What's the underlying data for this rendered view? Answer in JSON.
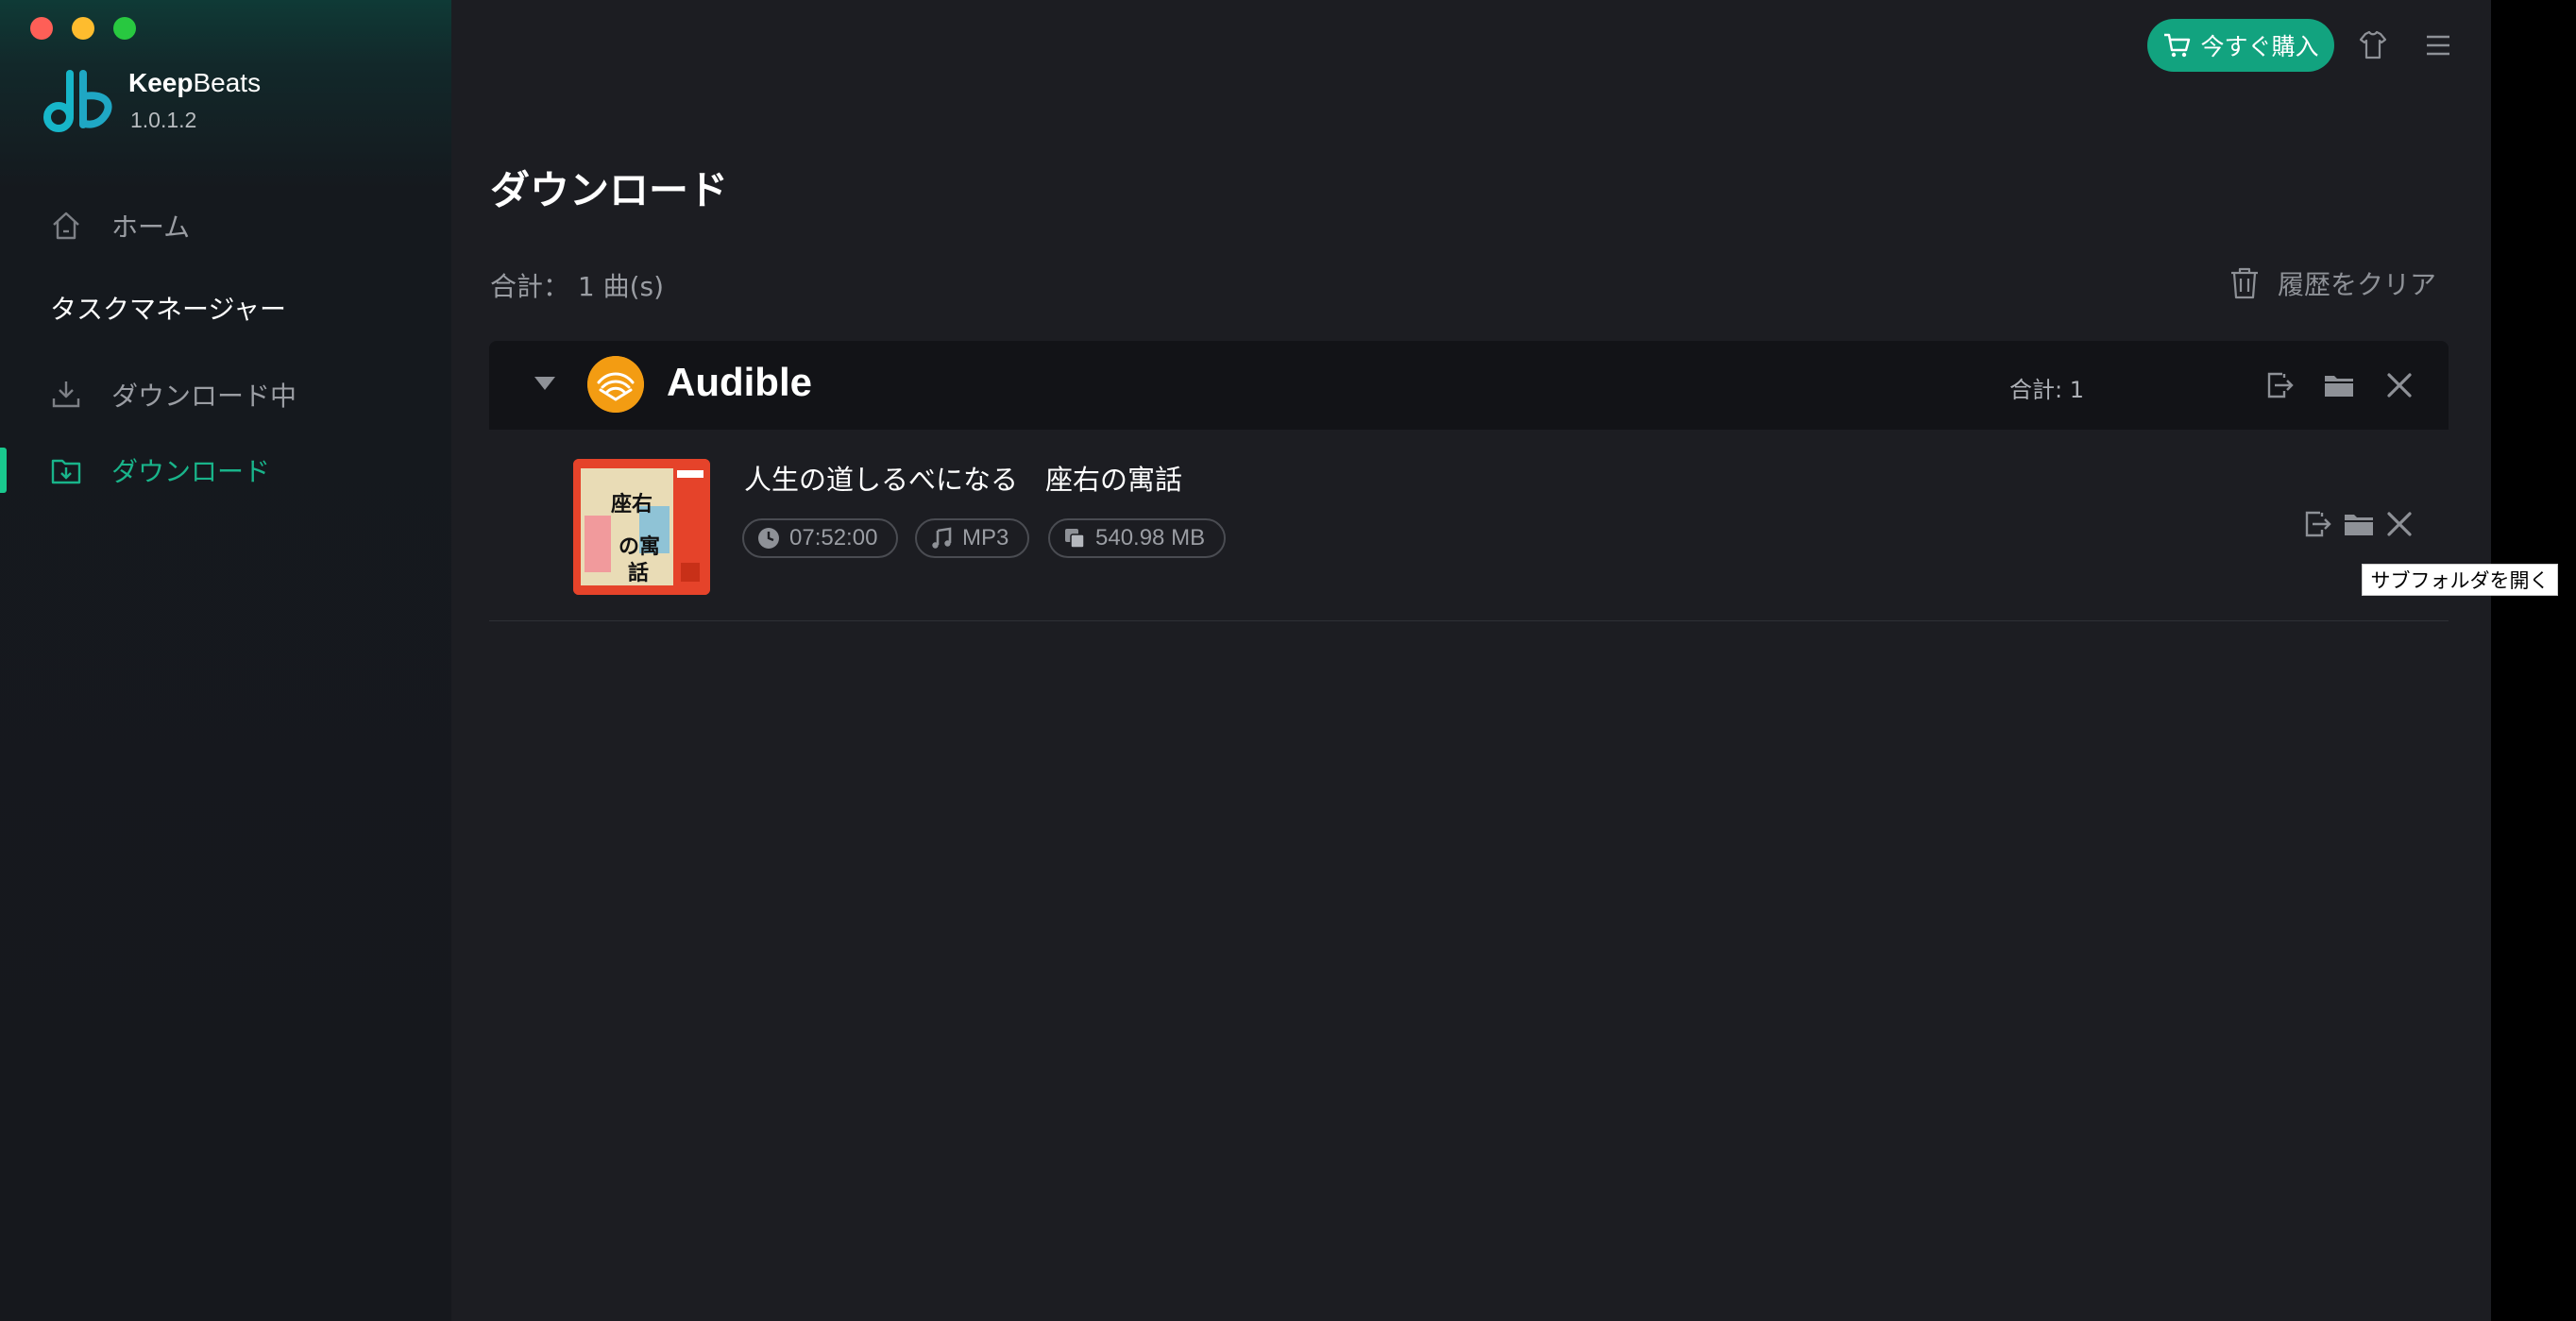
{
  "window": {
    "controls": [
      "close",
      "minimize",
      "maximize"
    ]
  },
  "app": {
    "brand_part1": "Keep",
    "brand_part2": "Beats",
    "version": "1.0.1.2",
    "accent": "#19b48a"
  },
  "sidebar": {
    "home_label": "ホーム",
    "section_label": "タスクマネージャー",
    "downloading_label": "ダウンロード中",
    "downloaded_label": "ダウンロード"
  },
  "header": {
    "buy_label": "今すぐ購入"
  },
  "main": {
    "title": "ダウンロード",
    "total_label": "合計： 1 曲(s)",
    "clear_label": "履歴をクリア"
  },
  "group": {
    "name": "Audible",
    "count_label": "合計: 1",
    "items": [
      {
        "title": "人生の道しるべになる　座右の寓話",
        "duration": "07:52:00",
        "format": "MP3",
        "size": "540.98 MB"
      }
    ]
  },
  "tooltip": "サブフォルダを開く",
  "icons": [
    "home-icon",
    "download-icon",
    "downloaded-icon",
    "cart-icon",
    "shirt-icon",
    "menu-icon",
    "trash-icon",
    "export-icon",
    "folder-icon",
    "close-icon",
    "clock-icon",
    "music-icon",
    "file-icon"
  ]
}
